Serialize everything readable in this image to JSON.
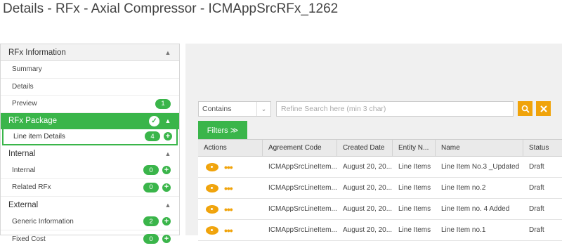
{
  "page_title": "Details - RFx - Axial Compressor - ICMAppSrcRFx_1262",
  "sidebar": {
    "rfx_information": {
      "header": "RFx Information",
      "items": [
        {
          "label": "Summary"
        },
        {
          "label": "Details"
        },
        {
          "label": "Preview",
          "badge": "1"
        }
      ]
    },
    "rfx_package": {
      "header": "RFx Package",
      "items": [
        {
          "label": "Line item Details",
          "badge": "4"
        }
      ]
    },
    "internal": {
      "header": "Internal",
      "items": [
        {
          "label": "Internal",
          "badge": "0"
        },
        {
          "label": "Related RFx",
          "badge": "0"
        }
      ]
    },
    "external": {
      "header": "External",
      "items": [
        {
          "label": "Generic Information",
          "badge": "2"
        },
        {
          "label": "Fixed Cost",
          "badge": "0"
        }
      ]
    }
  },
  "filter": {
    "select_value": "Contains",
    "search_placeholder": "Refine Search here (min 3 char)",
    "filters_label": "Filters ≫"
  },
  "table": {
    "columns": [
      "Actions",
      "Agreement Code",
      "Created Date",
      "Entity N...",
      "Name",
      "Status"
    ],
    "rows": [
      {
        "agreement_code": "ICMAppSrcLineItem...",
        "created_date": "August 20, 20...",
        "entity": "Line Items",
        "name": "Line Item No.3 _Updated",
        "status": "Draft"
      },
      {
        "agreement_code": "ICMAppSrcLineItem...",
        "created_date": "August 20, 20...",
        "entity": "Line Items",
        "name": "Line Item no.2",
        "status": "Draft"
      },
      {
        "agreement_code": "ICMAppSrcLineItem...",
        "created_date": "August 20, 20...",
        "entity": "Line Items",
        "name": "Line Item no. 4 Added",
        "status": "Draft"
      },
      {
        "agreement_code": "ICMAppSrcLineItem...",
        "created_date": "August 20, 20...",
        "entity": "Line Items",
        "name": "Line Item no.1",
        "status": "Draft"
      }
    ]
  },
  "colors": {
    "accent_green": "#3ab54a",
    "accent_orange": "#f0a30a"
  }
}
